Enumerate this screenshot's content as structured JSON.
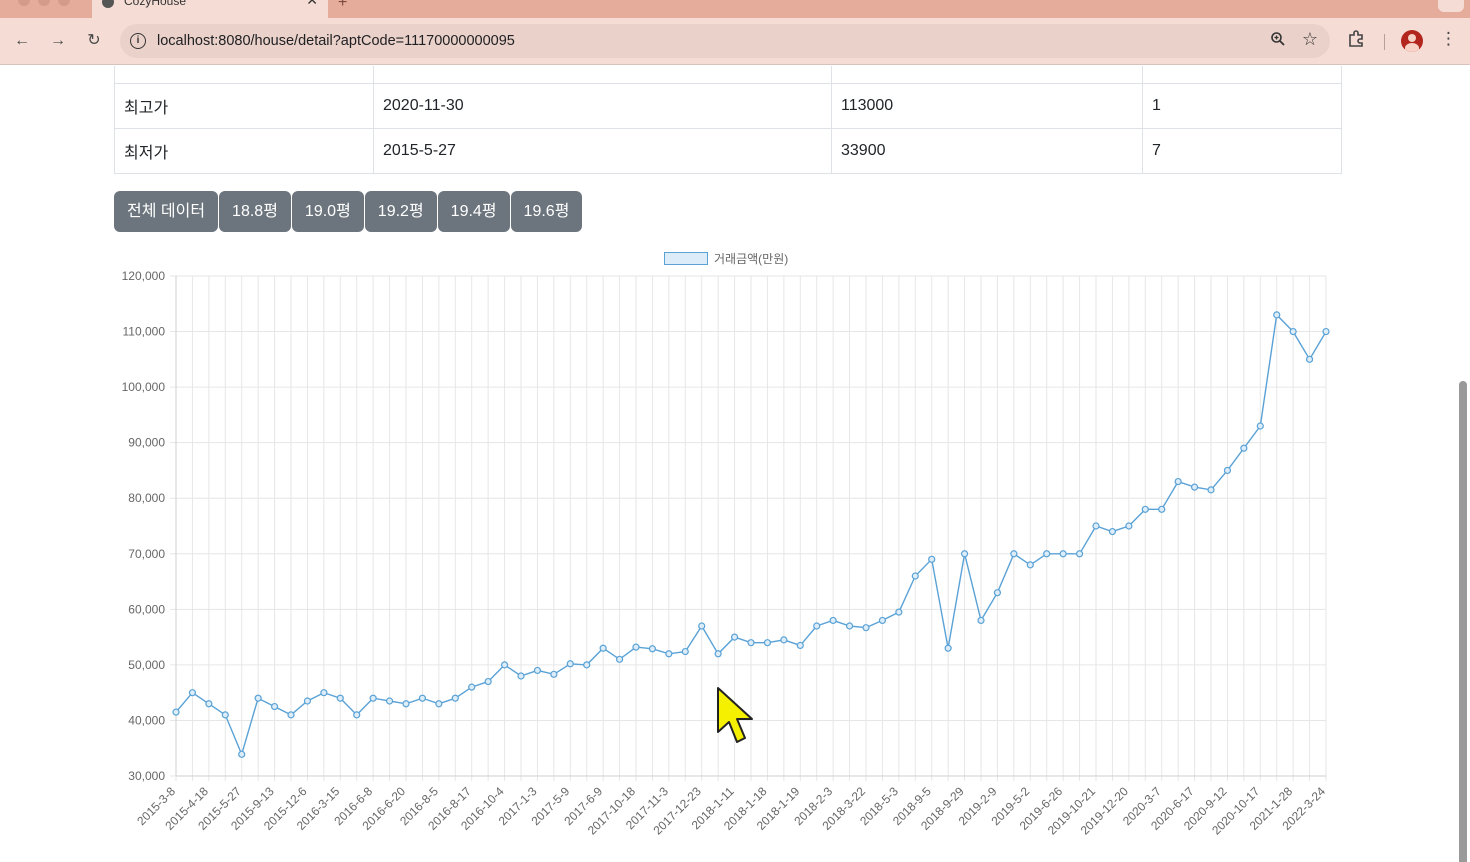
{
  "browser": {
    "tab_title": "CozyHouse",
    "url_host": "localhost",
    "url_rest": ":8080/house/detail?aptCode=11170000000095"
  },
  "table": {
    "rows": [
      {
        "label": "최고가",
        "date": "2020-11-30",
        "price": "113000",
        "floor": "1"
      },
      {
        "label": "최저가",
        "date": "2015-5-27",
        "price": "33900",
        "floor": "7"
      }
    ]
  },
  "filters": [
    "전체 데이터",
    "18.8평",
    "19.0평",
    "19.2평",
    "19.4평",
    "19.6평"
  ],
  "chart_data": {
    "type": "line",
    "legend": "거래금액(만원)",
    "legend_position": "top",
    "grid": true,
    "ylim": [
      30000,
      120000
    ],
    "y_ticks": [
      "120,000",
      "110,000",
      "100,000",
      "90,000",
      "80,000",
      "70,000",
      "60,000",
      "50,000",
      "40,000",
      "30,000"
    ],
    "x_tick_labels": [
      "2015-3-8",
      "2015-4-18",
      "2015-5-27",
      "2015-9-13",
      "2015-12-6",
      "2016-3-15",
      "2016-6-8",
      "2016-6-20",
      "2016-8-5",
      "2016-8-17",
      "2016-10-4",
      "2017-1-3",
      "2017-5-9",
      "2017-6-9",
      "2017-10-18",
      "2017-11-3",
      "2017-12-23",
      "2018-1-11",
      "2018-1-18",
      "2018-1-19",
      "2018-2-3",
      "2018-3-22",
      "2018-5-3",
      "2018-9-5",
      "2018-9-29",
      "2019-2-9",
      "2019-5-2",
      "2019-6-26",
      "2019-10-21",
      "2019-12-20",
      "2020-3-7",
      "2020-6-17",
      "2020-9-12",
      "2020-10-17",
      "2021-1-28",
      "2022-3-24"
    ],
    "series": [
      {
        "name": "거래금액(만원)",
        "color": "#5aa2d6",
        "values": [
          41500,
          45000,
          43000,
          41000,
          33900,
          44000,
          42500,
          41000,
          43500,
          45000,
          44000,
          41000,
          44000,
          43500,
          43000,
          44000,
          43000,
          44000,
          46000,
          47000,
          50000,
          48000,
          49000,
          48300,
          50200,
          50000,
          53000,
          51000,
          53200,
          52900,
          52000,
          52400,
          57000,
          52000,
          55000,
          54000,
          54000,
          54500,
          53500,
          57000,
          58000,
          57000,
          56700,
          58000,
          59500,
          66000,
          69000,
          53000,
          70000,
          58000,
          63000,
          70000,
          68000,
          70000,
          70000,
          70000,
          75000,
          74000,
          75000,
          78000,
          78000,
          83000,
          82000,
          81500,
          85000,
          89000,
          93000,
          113000,
          110000,
          105000,
          110000
        ]
      }
    ]
  }
}
